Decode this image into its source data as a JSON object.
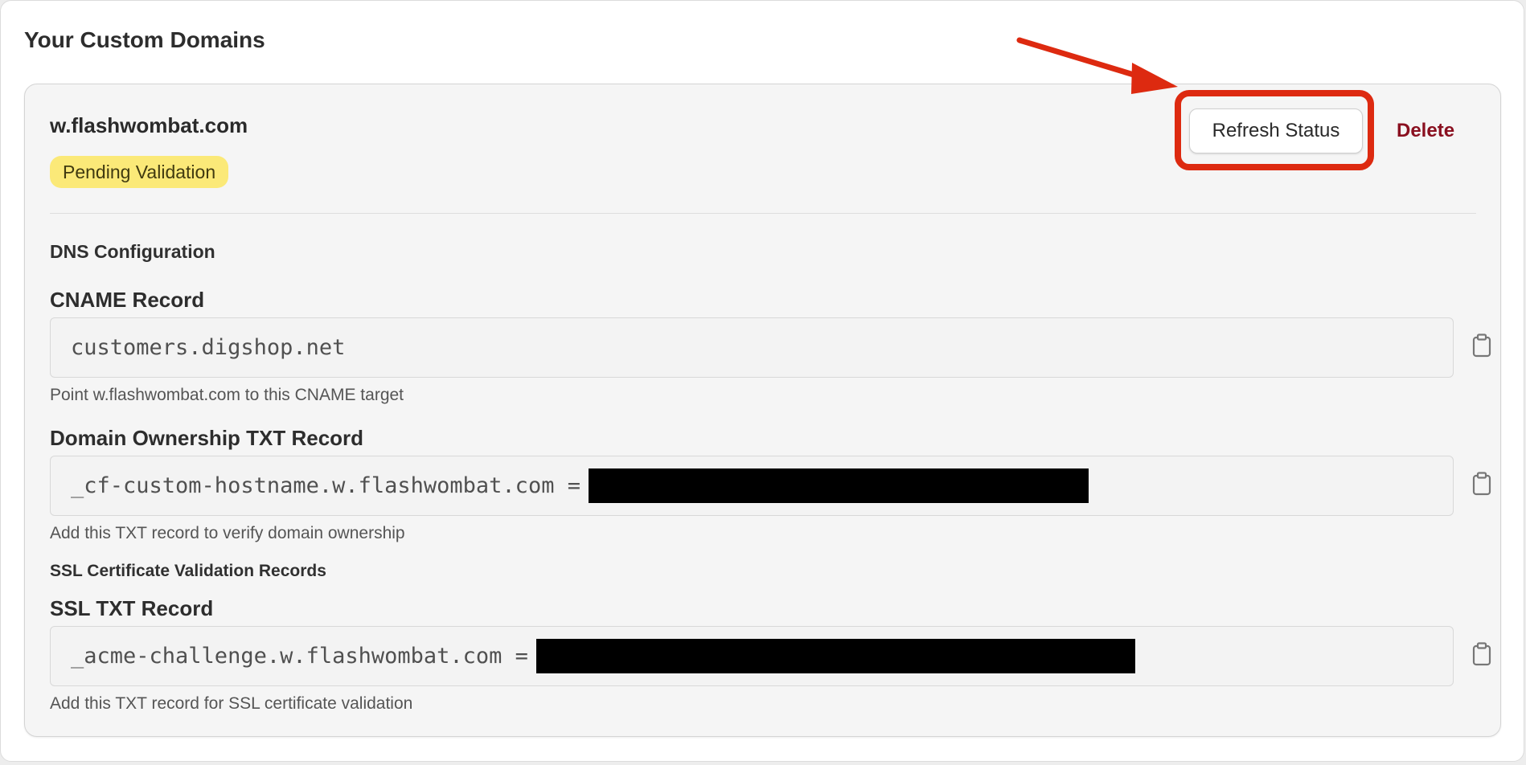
{
  "section": {
    "title": "Your Custom Domains"
  },
  "domain": {
    "name": "w.flashwombat.com",
    "status": "Pending Validation",
    "refresh_label": "Refresh Status",
    "delete_label": "Delete"
  },
  "dns": {
    "heading": "DNS Configuration",
    "cname": {
      "label": "CNAME Record",
      "value": "customers.digshop.net",
      "help": "Point w.flashwombat.com to this CNAME target"
    },
    "ownership_txt": {
      "label": "Domain Ownership TXT Record",
      "value_prefix": "_cf-custom-hostname.w.flashwombat.com =",
      "help": "Add this TXT record to verify domain ownership"
    },
    "ssl_heading": "SSL Certificate Validation Records",
    "ssl_txt": {
      "label": "SSL TXT Record",
      "value_prefix": "_acme-challenge.w.flashwombat.com =",
      "help": "Add this TXT record for SSL certificate validation"
    }
  },
  "colors": {
    "badge_bg": "#fbe978",
    "delete": "#8a1020",
    "annotation": "#dd2a10"
  },
  "icons": {
    "copy": "clipboard-icon"
  }
}
